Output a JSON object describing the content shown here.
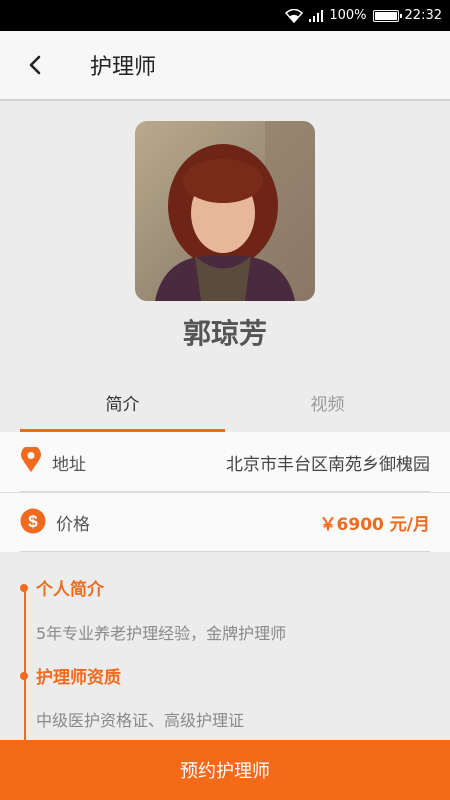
{
  "status_bar": {
    "battery": "100%",
    "time": "22:32",
    "battery_level": 1.0
  },
  "nav": {
    "title": "护理师"
  },
  "profile": {
    "name": "郭琼芳"
  },
  "tabs": [
    {
      "label": "简介",
      "active": true
    },
    {
      "label": "视频",
      "active": false
    }
  ],
  "info": {
    "address_label": "地址",
    "address_value": "北京市丰台区南苑乡御槐园",
    "price_label": "价格",
    "price_value": "￥6900 元/月"
  },
  "intro": {
    "personal_title": "个人简介",
    "personal_text": "5年专业养老护理经验，金牌护理师",
    "qualification_title": "护理师资质",
    "qualification_text": "中级医护资格证、高级护理证"
  },
  "actions": {
    "book_label": "预约护理师"
  },
  "colors": {
    "accent": "#f06b1e",
    "button": "#f46a19"
  }
}
